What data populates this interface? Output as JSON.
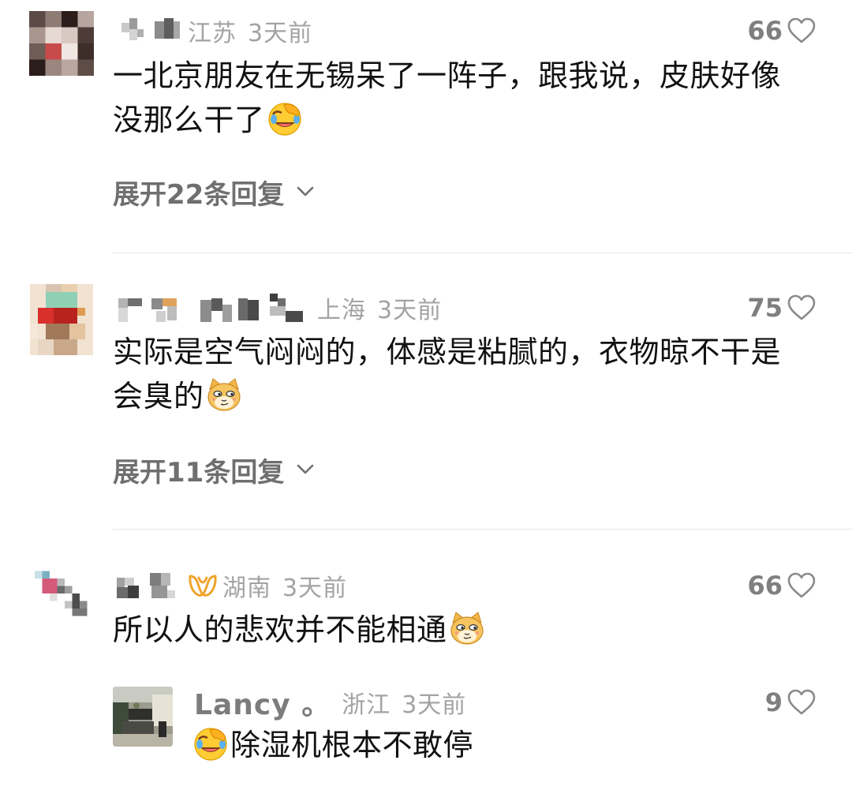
{
  "comments": [
    {
      "location": "江苏",
      "time": "3天前",
      "likes": "66",
      "text": "一北京朋友在无锡呆了一阵子，跟我说，皮肤好像没那么干了",
      "emoji": "facepalm-crying-emoji",
      "expand_label": "展开22条回复"
    },
    {
      "location": "上海",
      "time": "3天前",
      "likes": "75",
      "text": "实际是空气闷闷的，体感是粘腻的，衣物晾不干是会臭的",
      "emoji": "smirking-cat-emoji",
      "expand_label": "展开11条回复"
    },
    {
      "location": "湖南",
      "time": "3天前",
      "likes": "66",
      "text": "所以人的悲欢并不能相通",
      "emoji": "smirking-cat-emoji",
      "badge": "vip-badge-icon",
      "reply": {
        "name": "Lancy 。",
        "location": "浙江",
        "time": "3天前",
        "likes": "9",
        "emoji": "facepalm-crying-emoji",
        "text": "除湿机根本不敢停"
      }
    }
  ],
  "colors": {
    "meta": "#a3a3a3",
    "like": "#7f7f7f",
    "expand": "#6f6f6f",
    "divider": "#e6e6e6",
    "badge": "#f0a42b"
  }
}
